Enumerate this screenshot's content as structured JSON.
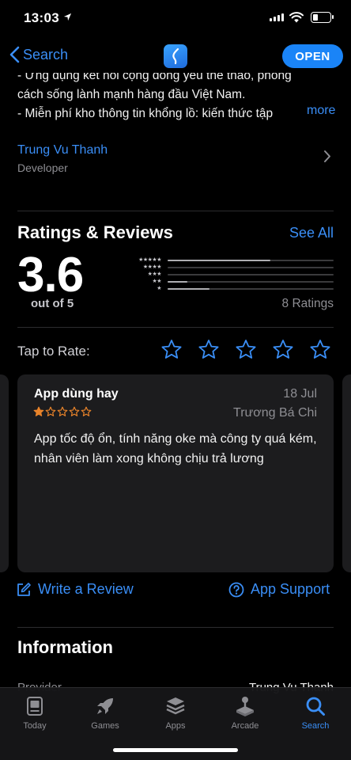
{
  "status_bar": {
    "time": "13:03"
  },
  "nav": {
    "back_label": "Search",
    "open_label": "OPEN"
  },
  "description": {
    "line1": "- Ứng dụng kết nối cộng đồng yêu thể thao, phong",
    "line2": "cách sống lành mạnh hàng đầu Việt Nam.",
    "line3": "- Miễn phí kho thông tin khổng lồ: kiến thức tập",
    "more_label": "more"
  },
  "developer": {
    "name": "Trung Vu Thanh",
    "label": "Developer"
  },
  "ratings": {
    "title": "Ratings & Reviews",
    "see_all": "See All",
    "average": "3.6",
    "out_of": "out of 5",
    "count_label": "8 Ratings",
    "histogram": [
      {
        "stars": "★★★★★",
        "fraction": 0.62
      },
      {
        "stars": "★★★★",
        "fraction": 0.0
      },
      {
        "stars": "★★★",
        "fraction": 0.0
      },
      {
        "stars": "★★",
        "fraction": 0.12
      },
      {
        "stars": "★",
        "fraction": 0.25
      }
    ]
  },
  "tap_to_rate": {
    "label": "Tap to Rate:"
  },
  "review": {
    "title": "App dùng hay",
    "date": "18 Jul",
    "author": "Trương Bá Chi",
    "rating": 1,
    "body": "App tốc độ ổn, tính năng oke mà công ty quá kém, nhân viên làm xong không chịu trả lương"
  },
  "actions": {
    "write_review": "Write a Review",
    "app_support": "App Support"
  },
  "information": {
    "title": "Information",
    "provider_label": "Provider",
    "provider_value": "Trung Vu Thanh"
  },
  "tabs": [
    {
      "label": "Today",
      "icon": "today-icon"
    },
    {
      "label": "Games",
      "icon": "rocket-icon"
    },
    {
      "label": "Apps",
      "icon": "layers-icon"
    },
    {
      "label": "Arcade",
      "icon": "joystick-icon"
    },
    {
      "label": "Search",
      "icon": "search-icon",
      "active": true
    }
  ],
  "colors": {
    "accent": "#3a8ef6",
    "star": "#e8832a",
    "background": "#000000",
    "card": "#1c1c1e"
  }
}
